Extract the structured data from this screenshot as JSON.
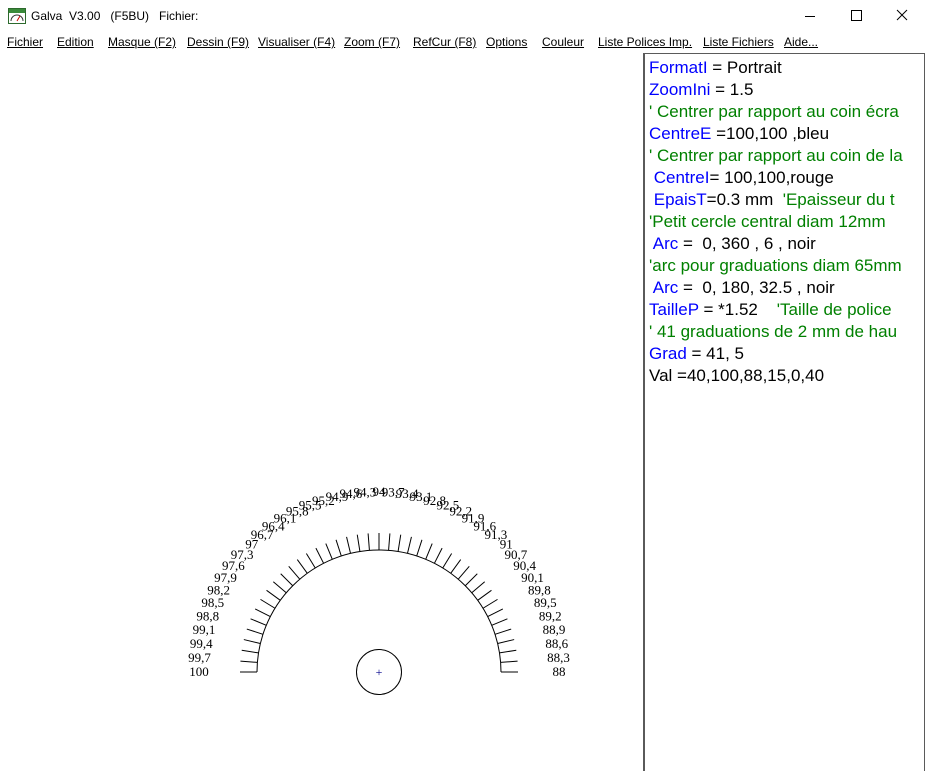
{
  "window": {
    "title": "Galva  V3.00   (F5BU)   Fichier:",
    "icon": "galvanometer-app-icon",
    "controls": [
      "minimize-icon",
      "maximize-icon",
      "close-icon"
    ]
  },
  "menu": [
    {
      "label": "Fichier"
    },
    {
      "label": "Edition"
    },
    {
      "label": "Masque (F2)"
    },
    {
      "label": "Dessin (F9)"
    },
    {
      "label": "Visualiser (F4)"
    },
    {
      "label": "Zoom (F7)"
    },
    {
      "label": "RefCur (F8)"
    },
    {
      "label": "Options"
    },
    {
      "label": "Couleur"
    },
    {
      "label": "Liste Polices Imp."
    },
    {
      "label": "Liste Fichiers"
    },
    {
      "label": "Aide..."
    }
  ],
  "colors": {
    "keyword": "#0000ff",
    "text": "#000000",
    "comment": "#008000",
    "border": "#5a5a5a"
  },
  "editor": {
    "lines": [
      [
        {
          "t": "FormatI",
          "c": "kw"
        },
        {
          "t": " = Portrait",
          "c": "txt"
        }
      ],
      [
        {
          "t": "ZoomIni",
          "c": "kw"
        },
        {
          "t": " = 1.5",
          "c": "txt"
        }
      ],
      [
        {
          "t": "' Centrer par rapport au coin écra",
          "c": "cm"
        }
      ],
      [
        {
          "t": "CentreE",
          "c": "kw"
        },
        {
          "t": " =100,100 ,bleu",
          "c": "txt"
        }
      ],
      [
        {
          "t": "' Centrer par rapport au coin de la",
          "c": "cm"
        }
      ],
      [
        {
          "t": " ",
          "c": "txt"
        },
        {
          "t": "CentreI",
          "c": "kw"
        },
        {
          "t": "= 100,100,rouge",
          "c": "txt"
        }
      ],
      [
        {
          "t": " ",
          "c": "txt"
        },
        {
          "t": "EpaisT",
          "c": "kw"
        },
        {
          "t": "=0.3 mm  ",
          "c": "txt"
        },
        {
          "t": "'Epaisseur du t",
          "c": "cm"
        }
      ],
      [
        {
          "t": "'Petit cercle central diam 12mm",
          "c": "cm"
        }
      ],
      [
        {
          "t": " ",
          "c": "txt"
        },
        {
          "t": "Arc",
          "c": "kw"
        },
        {
          "t": " =  0, 360 , 6 , noir",
          "c": "txt"
        }
      ],
      [
        {
          "t": "'arc pour graduations diam 65mm",
          "c": "cm"
        }
      ],
      [
        {
          "t": " ",
          "c": "txt"
        },
        {
          "t": "Arc",
          "c": "kw"
        },
        {
          "t": " =  0, 180, 32.5 , noir",
          "c": "txt"
        }
      ],
      [
        {
          "t": "TailleP",
          "c": "kw"
        },
        {
          "t": " = *1.52    ",
          "c": "txt"
        },
        {
          "t": "'Taille de police",
          "c": "cm"
        }
      ],
      [
        {
          "t": "' 41 graduations de 2 mm de hau",
          "c": "cm"
        }
      ],
      [
        {
          "t": "Grad",
          "c": "kw"
        },
        {
          "t": " = 41, 5",
          "c": "txt"
        }
      ],
      [
        {
          "t": "Val =40,100,88,15,0,40",
          "c": "txt"
        }
      ]
    ]
  },
  "drawing": {
    "graduation_count": 41,
    "scale_labels": [
      "100",
      "99,7",
      "99,4",
      "99,1",
      "98,8",
      "98,5",
      "98,2",
      "97,9",
      "97,6",
      "97,3",
      "97",
      "96,7",
      "96,4",
      "96,1",
      "95,8",
      "95,5",
      "95,2",
      "94,9",
      "94,6",
      "94,3",
      "94",
      "93,7",
      "93,4",
      "93,1",
      "92,8",
      "92,5",
      "92,2",
      "91,9",
      "91,6",
      "91,3",
      "91",
      "90,7",
      "90,4",
      "90,1",
      "89,8",
      "89,5",
      "89,2",
      "88,9",
      "88,6",
      "88,3",
      "88"
    ],
    "center_mark": "+"
  }
}
